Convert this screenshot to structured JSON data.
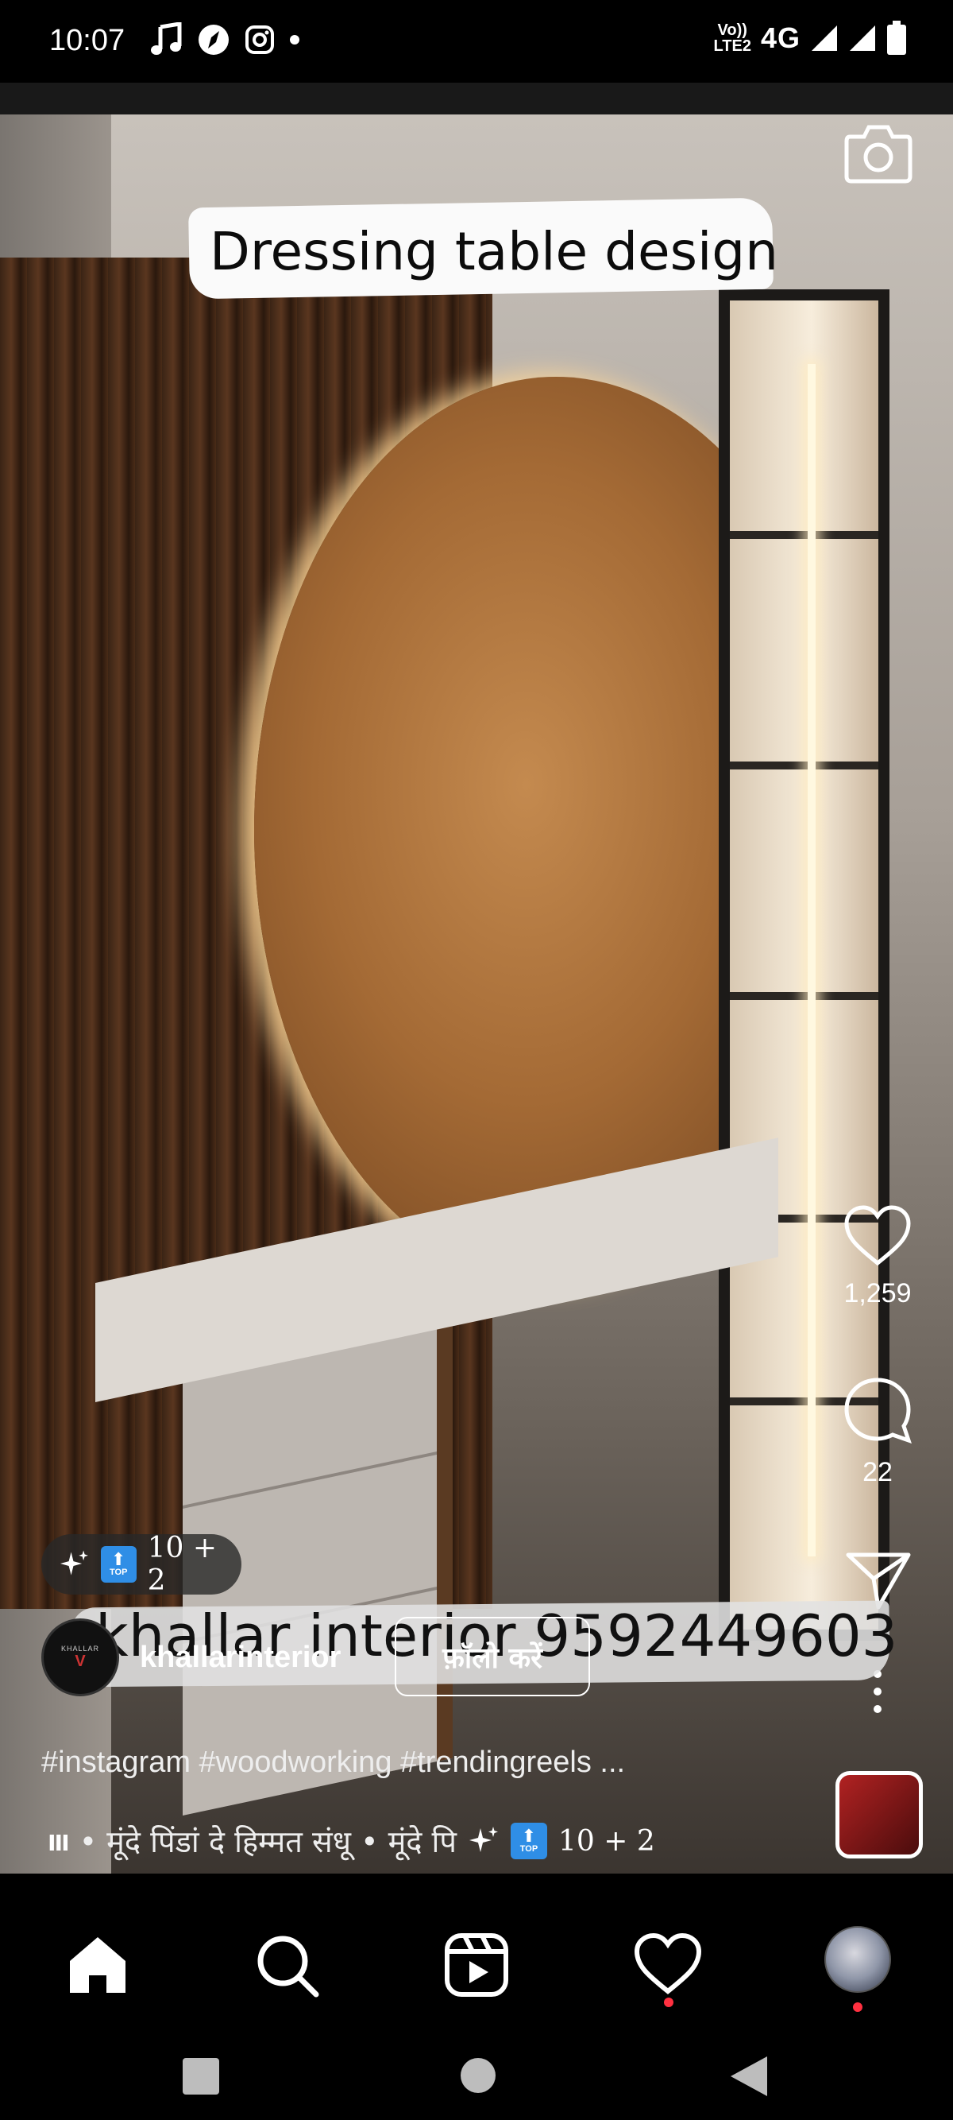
{
  "status_bar": {
    "time": "10:07",
    "network_label_top": "Vo))",
    "network_label_bottom": "LTE2",
    "network_type": "4G"
  },
  "reel": {
    "caption": "Dressing table design",
    "overlay_text": "khallar interior  9592449603",
    "effect_chip_label": "10 + 2",
    "top_badge": "TOP",
    "likes": "1,259",
    "comments": "22"
  },
  "author": {
    "username": "khallarinterior",
    "follow_label": "फ़ॉलो करें",
    "avatar_text": "KHALLAR"
  },
  "description": {
    "hashtags": "#instagram #woodworking #trendingreels ..."
  },
  "audio": {
    "track": "• मूंदे पिंडां दे   हिम्मत संधू • मूंदे पि",
    "effect_label": "10 + 2"
  },
  "colors": {
    "notification_dot": "#ff3040",
    "top_badge": "#2f8ee6"
  },
  "icons": {
    "nav": [
      "home-icon",
      "search-icon",
      "reels-icon",
      "heart-icon",
      "profile-avatar"
    ],
    "rail": [
      "heart-icon",
      "comment-icon",
      "share-icon",
      "more-icon"
    ]
  }
}
